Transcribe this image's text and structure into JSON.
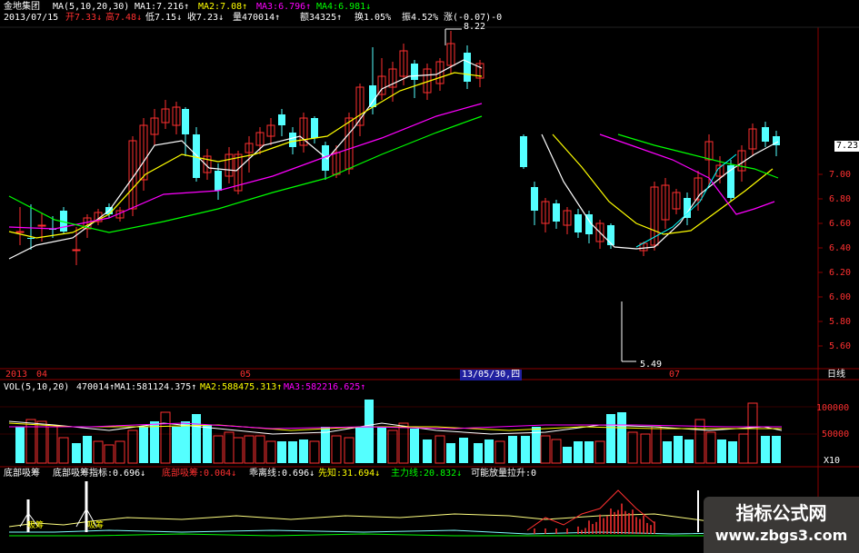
{
  "header": {
    "stock_name": "金地集团",
    "ma_label": "MA(5,10,20,30)",
    "ma1": "MA1:7.216↑",
    "ma2": "MA2:7.08↑",
    "ma3": "MA3:6.796↑",
    "ma4": "MA4:6.981↓",
    "date": "2013/07/15",
    "open": "开7.33↓",
    "high": "高7.48↓",
    "low": "低7.15↓",
    "close": "收7.23↓",
    "volume": "量470014↑",
    "amount": "额34325↑",
    "turnover": "换1.05%",
    "amplitude": "振4.52%",
    "change": "涨(-0.07)-0"
  },
  "price_axis": {
    "ticks": [
      "7.20",
      "7.00",
      "6.80",
      "6.60",
      "6.40",
      "6.20",
      "6.00",
      "5.80",
      "5.60"
    ],
    "current_tag": "7.23"
  },
  "annotations": {
    "high_mark": "8.22",
    "low_mark": "5.49"
  },
  "time_axis": {
    "labels": [
      "2013",
      "04",
      "05",
      "07"
    ],
    "cursor_date": "13/05/30,四",
    "period": "日线"
  },
  "volume_header": {
    "label": "VOL(5,10,20)",
    "vol": "470014↑",
    "ma1": "MA1:581124.375↑",
    "ma2": "MA2:588475.313↑",
    "ma3": "MA3:582216.625↑"
  },
  "volume_axis": {
    "ticks": [
      "100000",
      "50000"
    ],
    "unit": "X10"
  },
  "indicator_header": {
    "name": "底部吸筹",
    "a": "底部吸筹指标:0.696↓",
    "b": "底部吸筹:0.004↓",
    "c": "乖离线:0.696↓",
    "d": "先知:31.694↓",
    "e": "主力线:20.832↓",
    "f": "可能放量拉升:0"
  },
  "indicator_marks": [
    "吸筹",
    "吸筹"
  ],
  "watermark": {
    "title": "指标公式网",
    "url": "www.zbgs3.com"
  },
  "colors": {
    "up": "#ff3030",
    "down": "#54ffff",
    "ma_white": "#ffffff",
    "ma_yellow": "#ffff00",
    "ma_magenta": "#ff00ff",
    "ma_green": "#00ff00",
    "grid_red": "#8b0000"
  }
}
